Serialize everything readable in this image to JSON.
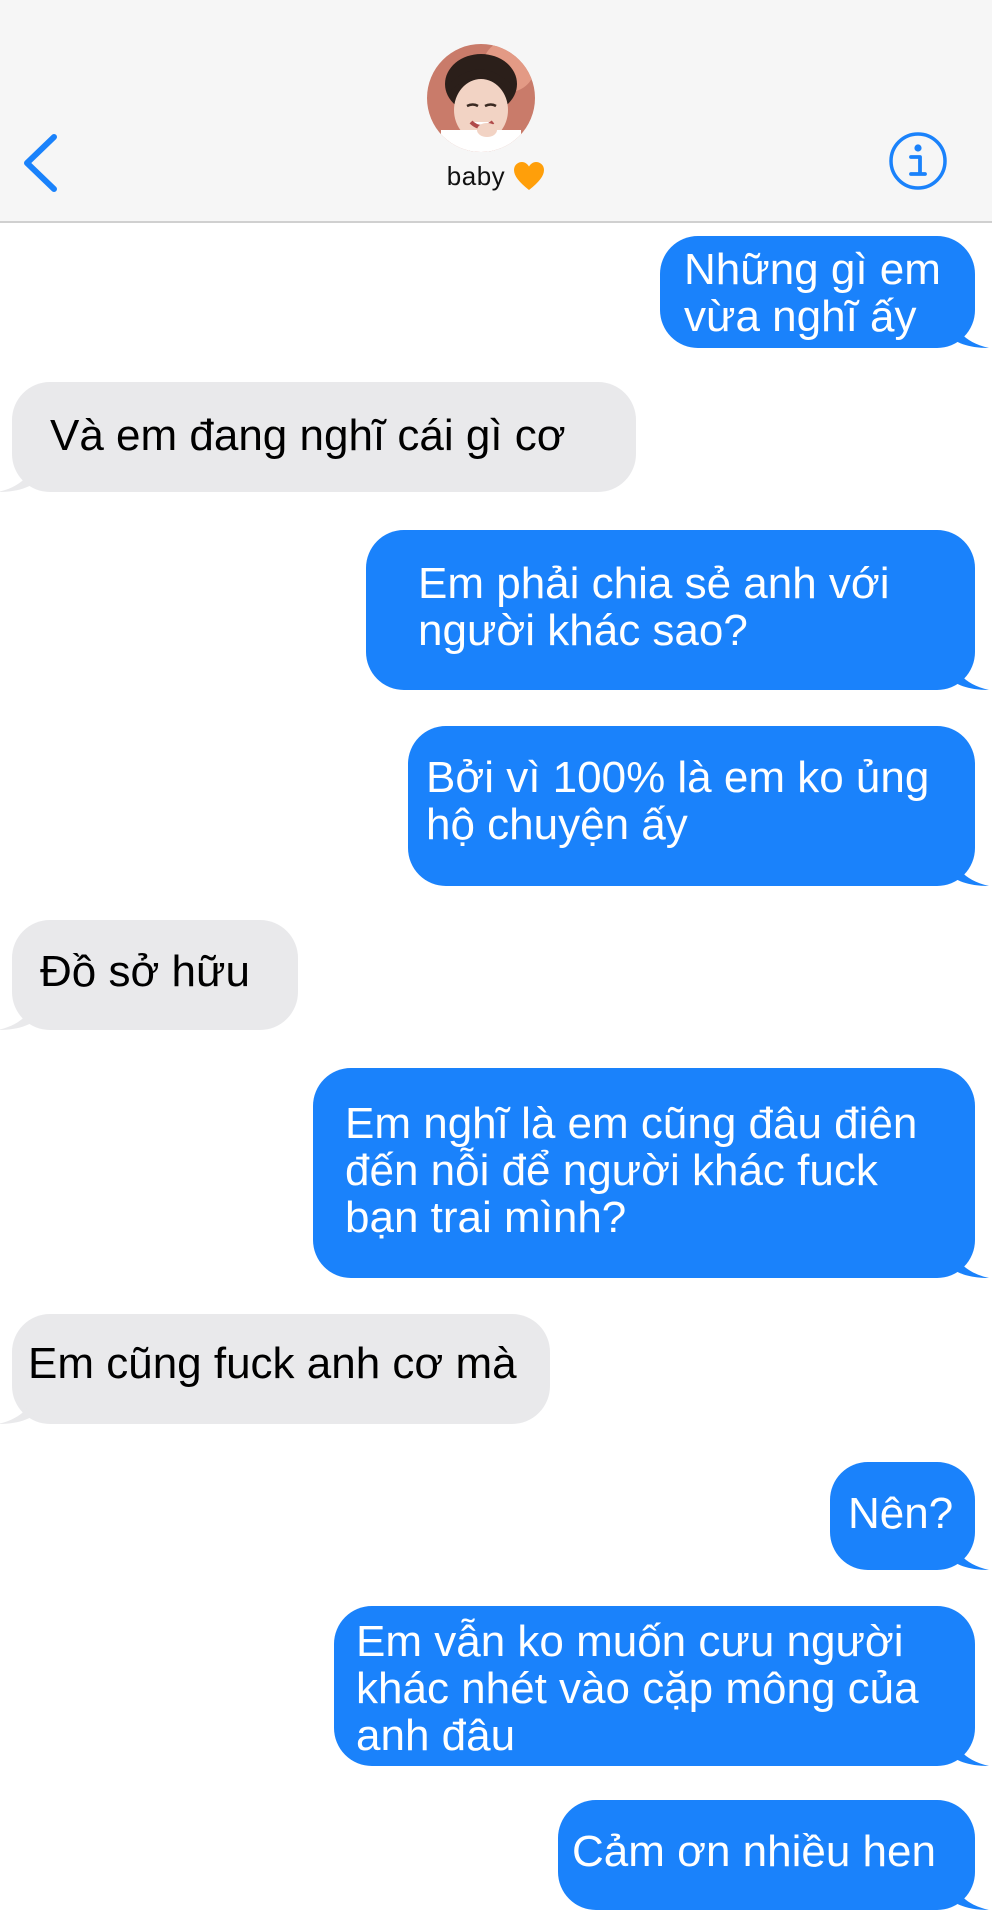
{
  "contact": {
    "name": "baby",
    "avatar_description": "photo of contact"
  },
  "icons": {
    "back": "chevron-left-icon",
    "info": "info-circle-icon",
    "heart": "orange-heart-emoji"
  },
  "colors": {
    "accent": "#1a82fb",
    "outgoing_bubble": "#1a82fb",
    "incoming_bubble": "#e9e9eb",
    "heart": "#ff9f0a",
    "header_bg": "#f6f6f6"
  },
  "messages": [
    {
      "direction": "outgoing",
      "text": "Những gì em\nvừa nghĩ ấy"
    },
    {
      "direction": "incoming",
      "text": "Và em đang nghĩ cái gì cơ"
    },
    {
      "direction": "outgoing",
      "text": "Em phải chia sẻ anh với\nngười khác sao?"
    },
    {
      "direction": "outgoing",
      "text": "Bởi vì 100% là em ko ủng\nhộ chuyện ấy"
    },
    {
      "direction": "incoming",
      "text": "Đồ sở hữu"
    },
    {
      "direction": "outgoing",
      "text": "Em nghĩ là em cũng đâu điên\nđến nỗi để người khác fuck\nbạn trai mình?"
    },
    {
      "direction": "incoming",
      "text": "Em cũng fuck anh cơ mà"
    },
    {
      "direction": "outgoing",
      "text": "Nên?"
    },
    {
      "direction": "outgoing",
      "text": "Em vẫn ko muốn cưu người\nkhác nhét vào cặp mông của\nanh đâu"
    },
    {
      "direction": "outgoing",
      "text": "Cảm ơn nhiều hen"
    }
  ]
}
